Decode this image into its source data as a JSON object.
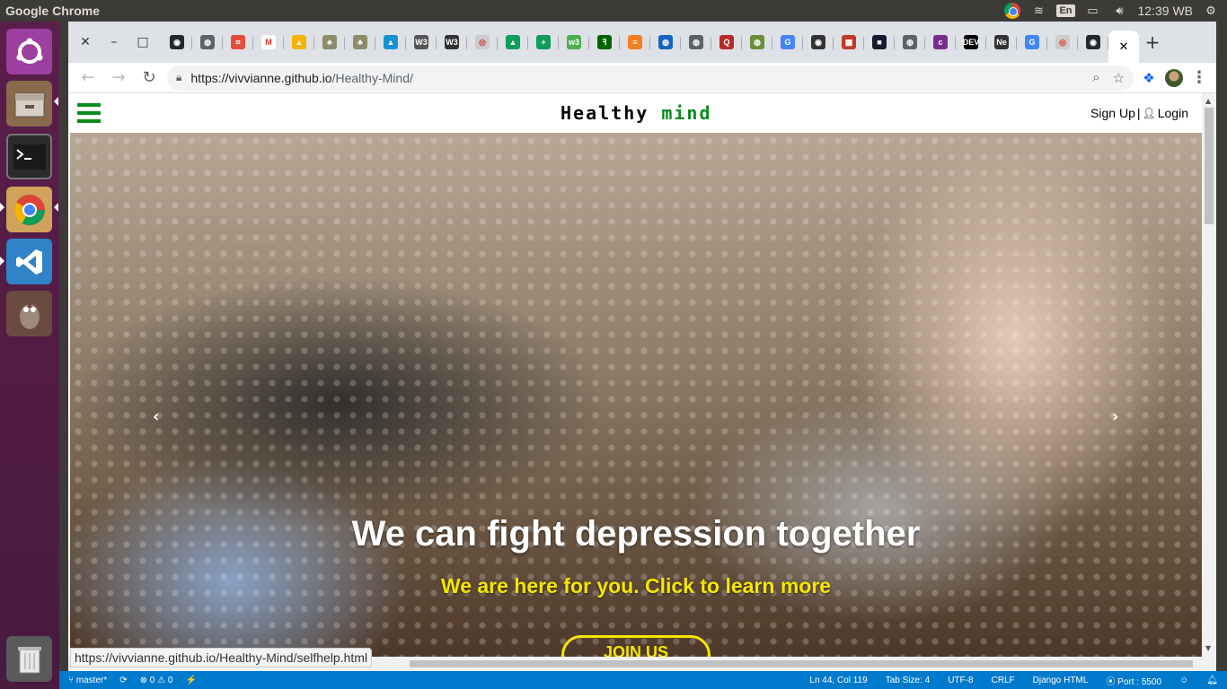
{
  "top_panel": {
    "app_title": "Google Chrome",
    "keyboard": "En",
    "clock": "12:39 WB"
  },
  "launcher": {
    "items": [
      "ubuntu-dash",
      "files",
      "terminal",
      "chrome",
      "vscode",
      "gimp",
      "trash"
    ]
  },
  "browser": {
    "tabs_favicons": [
      {
        "icon": "github-icon",
        "color": "#24292e",
        "glyph": "◉"
      },
      {
        "icon": "globe-icon",
        "color": "#5f6368",
        "glyph": "◍"
      },
      {
        "icon": "codepen-icon",
        "color": "#e44d3a",
        "glyph": "⌗"
      },
      {
        "icon": "gmail-icon",
        "color": "#ffffff",
        "glyph": "M"
      },
      {
        "icon": "drive-icon",
        "color": "#f4b400",
        "glyph": "▲"
      },
      {
        "icon": "tree-icon",
        "color": "#8d8d6b",
        "glyph": "♣"
      },
      {
        "icon": "tree-icon",
        "color": "#8d8d6b",
        "glyph": "♣"
      },
      {
        "icon": "arch-icon",
        "color": "#1793d1",
        "glyph": "▲"
      },
      {
        "icon": "w3-icon",
        "color": "#555555",
        "glyph": "W3"
      },
      {
        "icon": "w3-dark-icon",
        "color": "#333333",
        "glyph": "W3"
      },
      {
        "icon": "camera-icon",
        "color": "#cccccc",
        "glyph": "◎"
      },
      {
        "icon": "drive-icon",
        "color": "#0f9d58",
        "glyph": "▲"
      },
      {
        "icon": "cross-icon",
        "color": "#0f9d58",
        "glyph": "+"
      },
      {
        "icon": "w3-green-icon",
        "color": "#4caf50",
        "glyph": "w3"
      },
      {
        "icon": "freecodecamp-icon",
        "color": "#006400",
        "glyph": "ꟻ"
      },
      {
        "icon": "stackoverflow-icon",
        "color": "#f48024",
        "glyph": "≡"
      },
      {
        "icon": "globe-icon",
        "color": "#1565c0",
        "glyph": "◍"
      },
      {
        "icon": "globe-icon",
        "color": "#5f6368",
        "glyph": "◍"
      },
      {
        "icon": "quora-icon",
        "color": "#b92b27",
        "glyph": "Q"
      },
      {
        "icon": "globe-icon",
        "color": "#6a8d3a",
        "glyph": "◍"
      },
      {
        "icon": "google-icon",
        "color": "#4285f4",
        "glyph": "G"
      },
      {
        "icon": "circle-icon",
        "color": "#333333",
        "glyph": "◉"
      },
      {
        "icon": "grid-icon",
        "color": "#c0392b",
        "glyph": "▦"
      },
      {
        "icon": "bookmark-icon",
        "color": "#1a1a2e",
        "glyph": "■"
      },
      {
        "icon": "globe-icon",
        "color": "#5f6368",
        "glyph": "◍"
      },
      {
        "icon": "colorlib-icon",
        "color": "#7b2d8b",
        "glyph": "c"
      },
      {
        "icon": "dev-icon",
        "color": "#000000",
        "glyph": "DEV"
      },
      {
        "icon": "ne-icon",
        "color": "#333333",
        "glyph": "Ne"
      },
      {
        "icon": "google-icon",
        "color": "#4285f4",
        "glyph": "G"
      },
      {
        "icon": "camera-icon",
        "color": "#cccccc",
        "glyph": "◎"
      },
      {
        "icon": "github-icon",
        "color": "#24292e",
        "glyph": "◉"
      }
    ],
    "active_tab_close": "✕",
    "new_tab": "+",
    "url_host": "https://vivvianne.github.io",
    "url_path": "/Healthy-Mind/",
    "status_link": "https://vivvianne.github.io/Healthy-Mind/selfhelp.html"
  },
  "site": {
    "brand_first": "Healthy",
    "brand_second": "mind",
    "signup": "Sign Up",
    "separator": "|",
    "login": "Login",
    "hero_heading": "We can fight depression together",
    "hero_sub": "We are here for you. Click to learn more",
    "join_button": "JOIN US",
    "arrow_prev": "‹",
    "arrow_next": "›"
  },
  "vscode_status": {
    "branch": "master*",
    "errors": "0",
    "warnings": "0",
    "position": "Ln 44, Col 119",
    "tab_size": "Tab Size: 4",
    "encoding": "UTF-8",
    "eol": "CRLF",
    "language": "Django HTML",
    "port": "Port : 5500"
  }
}
